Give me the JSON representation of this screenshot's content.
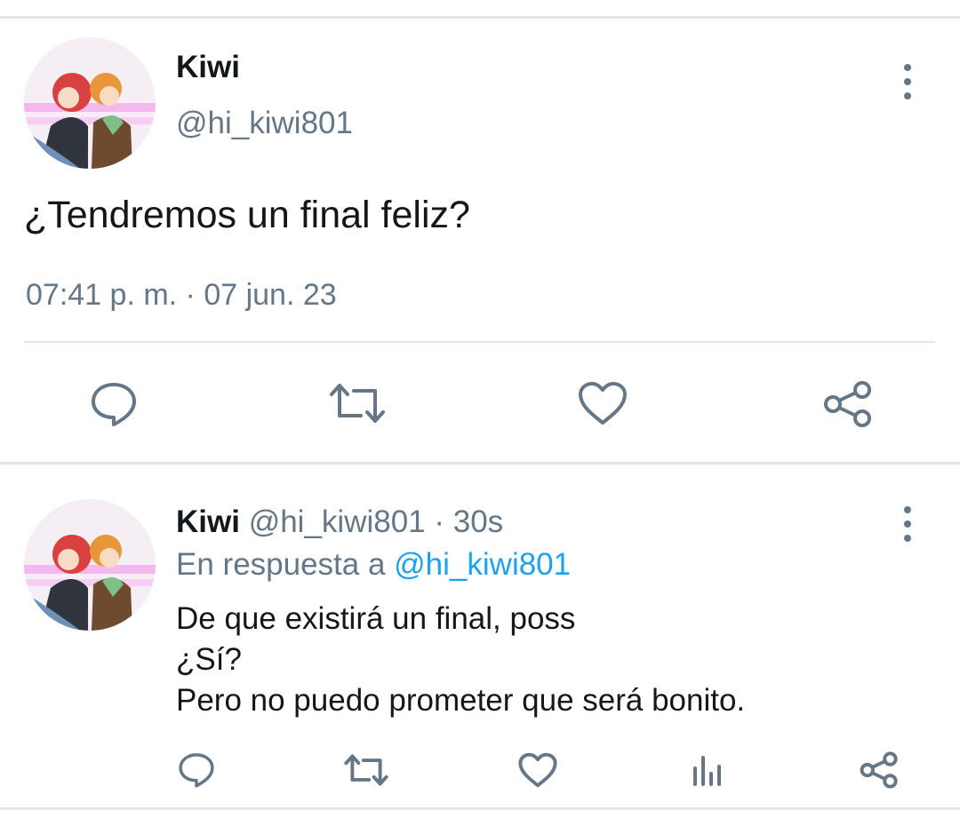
{
  "main_tweet": {
    "display_name": "Kiwi",
    "handle": "@hi_kiwi801",
    "text": "¿Tendremos un final feliz?",
    "timestamp": "07:41 p. m. · 07 jun. 23",
    "avatar_icon": "avatar-illustration",
    "actions": [
      "reply-icon",
      "retweet-icon",
      "like-icon",
      "share-icon"
    ]
  },
  "reply_tweet": {
    "display_name": "Kiwi",
    "handle_time": "@hi_kiwi801 · 30s",
    "reply_prefix": "En respuesta a ",
    "reply_to": "@hi_kiwi801",
    "lines": [
      "De que existirá un final, poss",
      "¿Sí?",
      "Pero no puedo prometer que será bonito."
    ],
    "actions": [
      "reply-icon",
      "retweet-icon",
      "like-icon",
      "analytics-icon",
      "share-icon"
    ]
  },
  "colors": {
    "text": "#14171a",
    "secondary": "#657786",
    "link": "#1da1f2",
    "divider": "#e1e6ea"
  }
}
